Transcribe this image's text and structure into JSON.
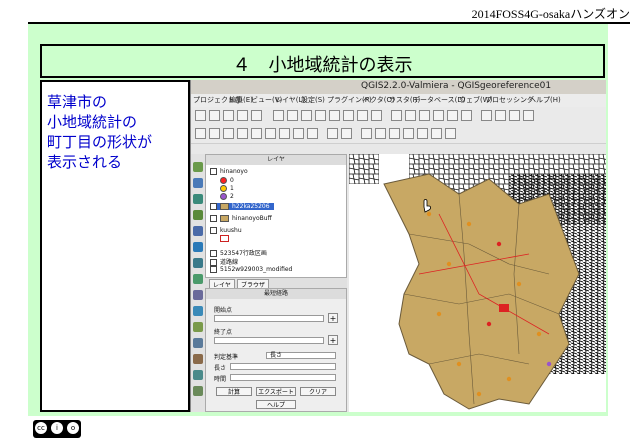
{
  "header": {
    "text": "2014FOSS4G-osakaハンズオン"
  },
  "slide": {
    "title": "４　小地域統計の表示",
    "description": [
      "草津市の",
      "小地域統計の",
      "町丁目の形状が",
      "表示される"
    ]
  },
  "app": {
    "window_title": "QGIS2.2.0-Valmiera - QGISgeoreference01",
    "menu": [
      "プロジェクト(J)",
      "編集(E)",
      "ビュー(V)",
      "レイヤ(L)",
      "設定(S)",
      "プラグイン(P)",
      "ベクタ(O)",
      "ラスタ(R)",
      "データベース(D)",
      "ウェブ(W)",
      "プロセッシング",
      "ヘルプ(H)"
    ],
    "layers_panel": {
      "title": "レイヤ",
      "items": [
        {
          "label": "hinanoyo",
          "checked": true,
          "swatch": ""
        },
        {
          "label": "0",
          "checked": false,
          "swatch": "#ff2222"
        },
        {
          "label": "1",
          "checked": false,
          "swatch": "#ffcc00"
        },
        {
          "label": "2",
          "checked": false,
          "swatch": "#9955cc"
        },
        {
          "label": "h22ka25206",
          "checked": true,
          "swatch": "#c8a864",
          "highlight": true
        },
        {
          "label": "hinanoyoBuff",
          "checked": false,
          "swatch": "#c8a864"
        },
        {
          "label": "kuushu",
          "checked": false,
          "swatch": "#ffffff"
        },
        {
          "label": "523547行政区画",
          "checked": true,
          "swatch": ""
        },
        {
          "label": "道路線",
          "checked": true,
          "swatch": ""
        },
        {
          "label": "5152w929003_modified",
          "checked": true,
          "swatch": ""
        }
      ]
    },
    "tabs": [
      "レイヤ",
      "ブラウザ"
    ],
    "route_panel": {
      "title": "最短経路",
      "start_label": "開始点",
      "end_label": "終了点",
      "criterion_label": "判定基準",
      "criterion_value": "長さ",
      "length_label": "長さ",
      "time_label": "時間",
      "calc_button": "計算",
      "export_button": "エクスポート",
      "clear_button": "クリア",
      "help_button": "ヘルプ"
    }
  },
  "colors": {
    "slide_bg": "#ccffcc",
    "desc_text": "#0000cc",
    "polygon_fill": "#c8a864",
    "point_fill": "#e09020",
    "red_marker": "#dd2222"
  }
}
